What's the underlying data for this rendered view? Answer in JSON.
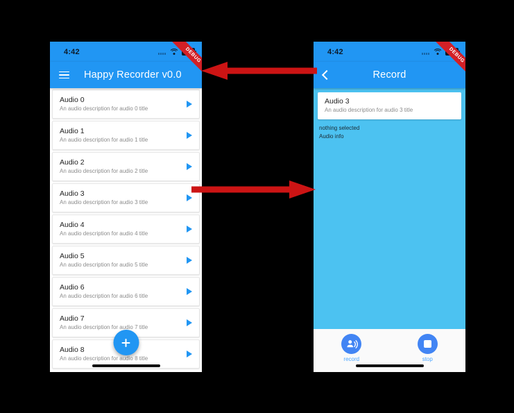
{
  "status_bar": {
    "time": "4:42",
    "icons": [
      "signal-icon",
      "wifi-icon",
      "battery-icon"
    ]
  },
  "debug_banner": {
    "label": "DEBUG",
    "color": "#d32026"
  },
  "theme": {
    "primary": "#2196f3",
    "accent": "#4285f4",
    "record_background": "#4cc2f1",
    "arrow_color": "#cc1414"
  },
  "left_phone": {
    "appbar": {
      "menu_icon": "hamburger-icon",
      "title": "Happy Recorder v0.0"
    },
    "list": [
      {
        "title": "Audio 0",
        "subtitle": "An audio description for audio 0 title",
        "action_icon": "play-icon"
      },
      {
        "title": "Audio 1",
        "subtitle": "An audio description for audio 1 title",
        "action_icon": "play-icon"
      },
      {
        "title": "Audio 2",
        "subtitle": "An audio description for audio 2 title",
        "action_icon": "play-icon"
      },
      {
        "title": "Audio 3",
        "subtitle": "An audio description for audio 3 title",
        "action_icon": "play-icon"
      },
      {
        "title": "Audio 4",
        "subtitle": "An audio description for audio 4 title",
        "action_icon": "play-icon"
      },
      {
        "title": "Audio 5",
        "subtitle": "An audio description for audio 5 title",
        "action_icon": "play-icon"
      },
      {
        "title": "Audio 6",
        "subtitle": "An audio description for audio 6 title",
        "action_icon": "play-icon"
      },
      {
        "title": "Audio 7",
        "subtitle": "An audio description for audio 7 title",
        "action_icon": "play-icon"
      },
      {
        "title": "Audio 8",
        "subtitle": "An audio description for audio 8 title",
        "action_icon": "play-icon"
      }
    ],
    "fab": {
      "icon": "plus-icon"
    }
  },
  "right_phone": {
    "appbar": {
      "back_icon": "back-chevron-icon",
      "title": "Record"
    },
    "selected_card": {
      "title": "Audio 3",
      "subtitle": "An audio description for audio 3 title"
    },
    "info": {
      "line1": "nothing selected",
      "line2": "Audio info"
    },
    "actions": [
      {
        "label": "record",
        "icon": "record-voice-icon"
      },
      {
        "label": "stop",
        "icon": "stop-square-icon"
      }
    ]
  },
  "annotations": {
    "arrows": [
      {
        "name": "arrow-back-to-list",
        "direction": "left"
      },
      {
        "name": "arrow-item-to-record",
        "direction": "right"
      }
    ]
  }
}
